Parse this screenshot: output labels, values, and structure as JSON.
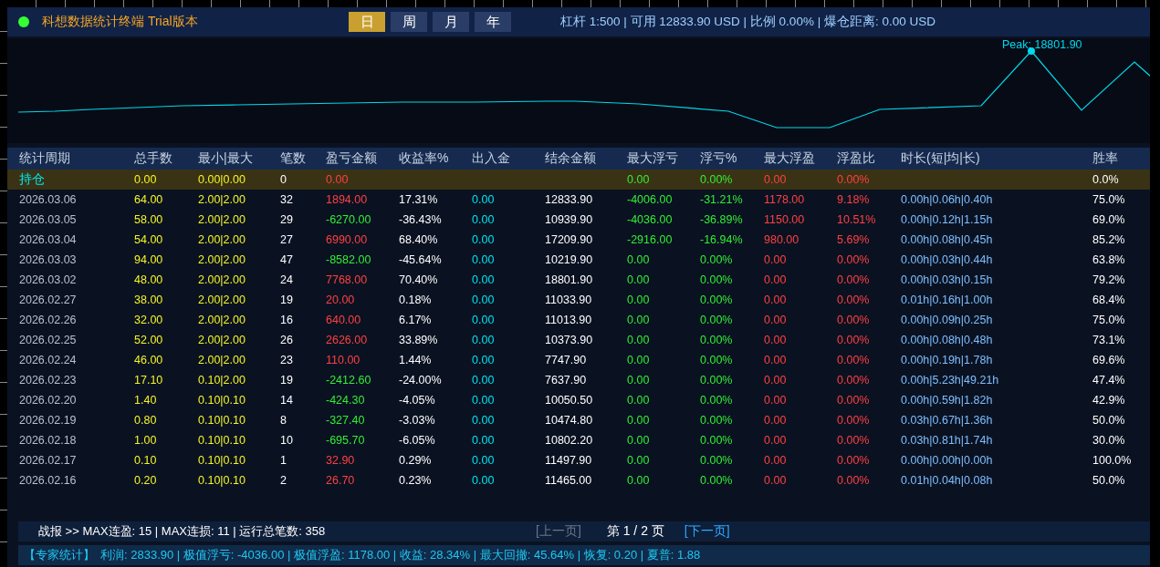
{
  "header": {
    "title": "科想数据统计终端 Trial版本",
    "online": true,
    "tabs": [
      {
        "label": "日",
        "selected": true
      },
      {
        "label": "周",
        "selected": false
      },
      {
        "label": "月",
        "selected": false
      },
      {
        "label": "年",
        "selected": false
      }
    ],
    "account_info": "杠杆 1:500 | 可用 12833.90 USD | 比例 0.00% | 爆仓距离: 0.00 USD"
  },
  "chart": {
    "peak_label": "Peak: 18801.90"
  },
  "table": {
    "columns": [
      "统计周期",
      "总手数",
      "最小|最大",
      "笔数",
      "盈亏金额",
      "收益率%",
      "出入金",
      "结余金额",
      "最大浮亏",
      "浮亏%",
      "最大浮盈",
      "浮盈比",
      "时长(短|均|长)",
      "胜率"
    ],
    "holding": {
      "period": "持仓",
      "lots": "0.00",
      "min_max": "0.00|0.00",
      "trades": "0",
      "pnl": "0.00",
      "max_float_loss": "0.00",
      "float_loss_pct": "0.00%",
      "max_float_profit": "0.00",
      "float_profit_ratio": "0.00%",
      "win_rate": "0.0%"
    },
    "rows": [
      {
        "period": "2026.03.06",
        "lots": "64.00",
        "min_max": "2.00|2.00",
        "trades": "32",
        "pnl": "1894.00",
        "profit": true,
        "return": "17.31%",
        "cash_flow": "0.00",
        "balance": "12833.90",
        "max_float_loss": "-4006.00",
        "float_loss_pct": "-31.21%",
        "max_float_profit": "1178.00",
        "float_profit_ratio": "9.18%",
        "duration": "0.00h|0.06h|0.40h",
        "win_rate": "75.0%"
      },
      {
        "period": "2026.03.05",
        "lots": "58.00",
        "min_max": "2.00|2.00",
        "trades": "29",
        "pnl": "-6270.00",
        "profit": false,
        "return": "-36.43%",
        "cash_flow": "0.00",
        "balance": "10939.90",
        "max_float_loss": "-4036.00",
        "float_loss_pct": "-36.89%",
        "max_float_profit": "1150.00",
        "float_profit_ratio": "10.51%",
        "duration": "0.00h|0.12h|1.15h",
        "win_rate": "69.0%"
      },
      {
        "period": "2026.03.04",
        "lots": "54.00",
        "min_max": "2.00|2.00",
        "trades": "27",
        "pnl": "6990.00",
        "profit": true,
        "return": "68.40%",
        "cash_flow": "0.00",
        "balance": "17209.90",
        "max_float_loss": "-2916.00",
        "float_loss_pct": "-16.94%",
        "max_float_profit": "980.00",
        "float_profit_ratio": "5.69%",
        "duration": "0.00h|0.08h|0.45h",
        "win_rate": "85.2%"
      },
      {
        "period": "2026.03.03",
        "lots": "94.00",
        "min_max": "2.00|2.00",
        "trades": "47",
        "pnl": "-8582.00",
        "profit": false,
        "return": "-45.64%",
        "cash_flow": "0.00",
        "balance": "10219.90",
        "max_float_loss": "0.00",
        "float_loss_pct": "0.00%",
        "max_float_profit": "0.00",
        "float_profit_ratio": "0.00%",
        "duration": "0.00h|0.03h|0.44h",
        "win_rate": "63.8%"
      },
      {
        "period": "2026.03.02",
        "lots": "48.00",
        "min_max": "2.00|2.00",
        "trades": "24",
        "pnl": "7768.00",
        "profit": true,
        "return": "70.40%",
        "cash_flow": "0.00",
        "balance": "18801.90",
        "max_float_loss": "0.00",
        "float_loss_pct": "0.00%",
        "max_float_profit": "0.00",
        "float_profit_ratio": "0.00%",
        "duration": "0.00h|0.03h|0.15h",
        "win_rate": "79.2%"
      },
      {
        "period": "2026.02.27",
        "lots": "38.00",
        "min_max": "2.00|2.00",
        "trades": "19",
        "pnl": "20.00",
        "profit": true,
        "return": "0.18%",
        "cash_flow": "0.00",
        "balance": "11033.90",
        "max_float_loss": "0.00",
        "float_loss_pct": "0.00%",
        "max_float_profit": "0.00",
        "float_profit_ratio": "0.00%",
        "duration": "0.01h|0.16h|1.00h",
        "win_rate": "68.4%"
      },
      {
        "period": "2026.02.26",
        "lots": "32.00",
        "min_max": "2.00|2.00",
        "trades": "16",
        "pnl": "640.00",
        "profit": true,
        "return": "6.17%",
        "cash_flow": "0.00",
        "balance": "11013.90",
        "max_float_loss": "0.00",
        "float_loss_pct": "0.00%",
        "max_float_profit": "0.00",
        "float_profit_ratio": "0.00%",
        "duration": "0.00h|0.09h|0.25h",
        "win_rate": "75.0%"
      },
      {
        "period": "2026.02.25",
        "lots": "52.00",
        "min_max": "2.00|2.00",
        "trades": "26",
        "pnl": "2626.00",
        "profit": true,
        "return": "33.89%",
        "cash_flow": "0.00",
        "balance": "10373.90",
        "max_float_loss": "0.00",
        "float_loss_pct": "0.00%",
        "max_float_profit": "0.00",
        "float_profit_ratio": "0.00%",
        "duration": "0.00h|0.08h|0.48h",
        "win_rate": "73.1%"
      },
      {
        "period": "2026.02.24",
        "lots": "46.00",
        "min_max": "2.00|2.00",
        "trades": "23",
        "pnl": "110.00",
        "profit": true,
        "return": "1.44%",
        "cash_flow": "0.00",
        "balance": "7747.90",
        "max_float_loss": "0.00",
        "float_loss_pct": "0.00%",
        "max_float_profit": "0.00",
        "float_profit_ratio": "0.00%",
        "duration": "0.00h|0.19h|1.78h",
        "win_rate": "69.6%"
      },
      {
        "period": "2026.02.23",
        "lots": "17.10",
        "min_max": "0.10|2.00",
        "trades": "19",
        "pnl": "-2412.60",
        "profit": false,
        "return": "-24.00%",
        "cash_flow": "0.00",
        "balance": "7637.90",
        "max_float_loss": "0.00",
        "float_loss_pct": "0.00%",
        "max_float_profit": "0.00",
        "float_profit_ratio": "0.00%",
        "duration": "0.00h|5.23h|49.21h",
        "win_rate": "47.4%"
      },
      {
        "period": "2026.02.20",
        "lots": "1.40",
        "min_max": "0.10|0.10",
        "trades": "14",
        "pnl": "-424.30",
        "profit": false,
        "return": "-4.05%",
        "cash_flow": "0.00",
        "balance": "10050.50",
        "max_float_loss": "0.00",
        "float_loss_pct": "0.00%",
        "max_float_profit": "0.00",
        "float_profit_ratio": "0.00%",
        "duration": "0.00h|0.59h|1.82h",
        "win_rate": "42.9%"
      },
      {
        "period": "2026.02.19",
        "lots": "0.80",
        "min_max": "0.10|0.10",
        "trades": "8",
        "pnl": "-327.40",
        "profit": false,
        "return": "-3.03%",
        "cash_flow": "0.00",
        "balance": "10474.80",
        "max_float_loss": "0.00",
        "float_loss_pct": "0.00%",
        "max_float_profit": "0.00",
        "float_profit_ratio": "0.00%",
        "duration": "0.03h|0.67h|1.36h",
        "win_rate": "50.0%"
      },
      {
        "period": "2026.02.18",
        "lots": "1.00",
        "min_max": "0.10|0.10",
        "trades": "10",
        "pnl": "-695.70",
        "profit": false,
        "return": "-6.05%",
        "cash_flow": "0.00",
        "balance": "10802.20",
        "max_float_loss": "0.00",
        "float_loss_pct": "0.00%",
        "max_float_profit": "0.00",
        "float_profit_ratio": "0.00%",
        "duration": "0.03h|0.81h|1.74h",
        "win_rate": "30.0%"
      },
      {
        "period": "2026.02.17",
        "lots": "0.10",
        "min_max": "0.10|0.10",
        "trades": "1",
        "pnl": "32.90",
        "profit": true,
        "return": "0.29%",
        "cash_flow": "0.00",
        "balance": "11497.90",
        "max_float_loss": "0.00",
        "float_loss_pct": "0.00%",
        "max_float_profit": "0.00",
        "float_profit_ratio": "0.00%",
        "duration": "0.00h|0.00h|0.00h",
        "win_rate": "100.0%"
      },
      {
        "period": "2026.02.16",
        "lots": "0.20",
        "min_max": "0.10|0.10",
        "trades": "2",
        "pnl": "26.70",
        "profit": true,
        "return": "0.23%",
        "cash_flow": "0.00",
        "balance": "11465.00",
        "max_float_loss": "0.00",
        "float_loss_pct": "0.00%",
        "max_float_profit": "0.00",
        "float_profit_ratio": "0.00%",
        "duration": "0.01h|0.04h|0.08h",
        "win_rate": "50.0%"
      }
    ]
  },
  "footer": {
    "summary": "战报 >> MAX连盈: 15 | MAX连损: 11 | 运行总笔数: 358",
    "prev": {
      "label": "[上一页]",
      "disabled": true
    },
    "page": "第 1 / 2 页",
    "next": {
      "label": "[下一页]",
      "disabled": false
    }
  },
  "expert_stats": {
    "label": "【专家统计】",
    "text": "利润: 2833.90 | 极值浮亏: -4036.00 | 极值浮盈: 1178.00 | 收益: 28.34% | 最大回撤: 45.64% | 恢复: 0.20 | 夏普: 1.88"
  }
}
